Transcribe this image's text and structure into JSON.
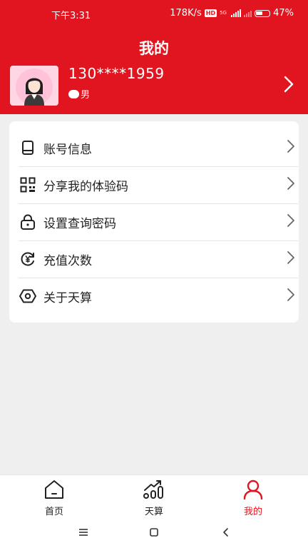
{
  "status_bar": {
    "time": "下午3:31",
    "network_speed": "178K/s",
    "hd_badge": "HD",
    "network_type": "5G",
    "battery": "47%"
  },
  "header": {
    "title": "我的"
  },
  "profile": {
    "phone": "130****1959",
    "gender": "男"
  },
  "menu": {
    "items": [
      {
        "label": "账号信息",
        "icon": "phone-icon"
      },
      {
        "label": "分享我的体验码",
        "icon": "qr-code-icon"
      },
      {
        "label": "设置查询密码",
        "icon": "lock-icon"
      },
      {
        "label": "充值次数",
        "icon": "yen-refresh-icon"
      },
      {
        "label": "关于天算",
        "icon": "eye-hexagon-icon"
      }
    ]
  },
  "tabbar": {
    "tabs": [
      {
        "label": "首页",
        "icon": "home-icon"
      },
      {
        "label": "天算",
        "icon": "chart-icon"
      },
      {
        "label": "我的",
        "icon": "person-icon",
        "active": true
      }
    ]
  },
  "colors": {
    "brand_red": "#e0151f",
    "background": "#efefef"
  }
}
